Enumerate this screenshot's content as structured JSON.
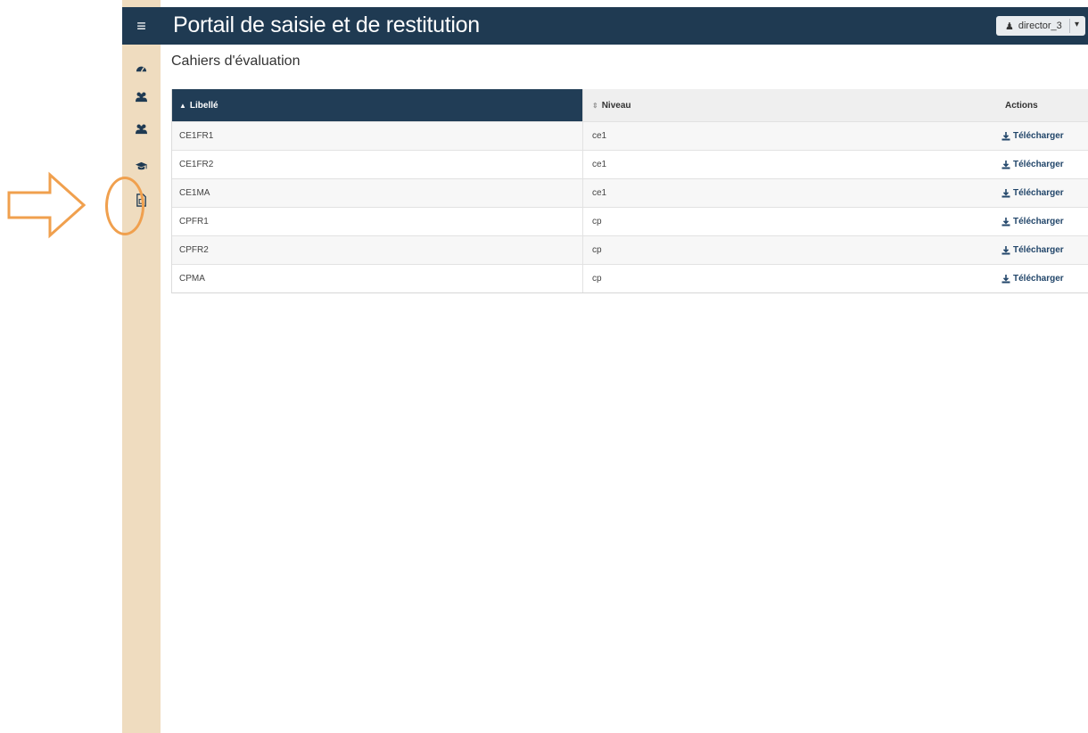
{
  "header": {
    "title": "Portail de saisie et de restitution",
    "user": "director_3"
  },
  "sidebar": {
    "items": [
      {
        "icon": "dashboard-icon"
      },
      {
        "icon": "users-icon"
      },
      {
        "icon": "users-icon"
      },
      {
        "icon": "graduation-cap-icon"
      },
      {
        "icon": "pdf-file-icon",
        "highlighted": true
      }
    ]
  },
  "page": {
    "title": "Cahiers d'évaluation"
  },
  "table": {
    "columns": [
      "Libellé",
      "Niveau",
      "Actions"
    ],
    "rows": [
      {
        "libelle": "CE1FR1",
        "niveau": "ce1",
        "action": "Télécharger"
      },
      {
        "libelle": "CE1FR2",
        "niveau": "ce1",
        "action": "Télécharger"
      },
      {
        "libelle": "CE1MA",
        "niveau": "ce1",
        "action": "Télécharger"
      },
      {
        "libelle": "CPFR1",
        "niveau": "cp",
        "action": "Télécharger"
      },
      {
        "libelle": "CPFR2",
        "niveau": "cp",
        "action": "Télécharger"
      },
      {
        "libelle": "CPMA",
        "niveau": "cp",
        "action": "Télécharger"
      }
    ]
  },
  "colors": {
    "header_bg": "#1f3a52",
    "sidebar_bg": "#efdcbf",
    "annotation": "#f0a04e",
    "link": "#22466a"
  }
}
